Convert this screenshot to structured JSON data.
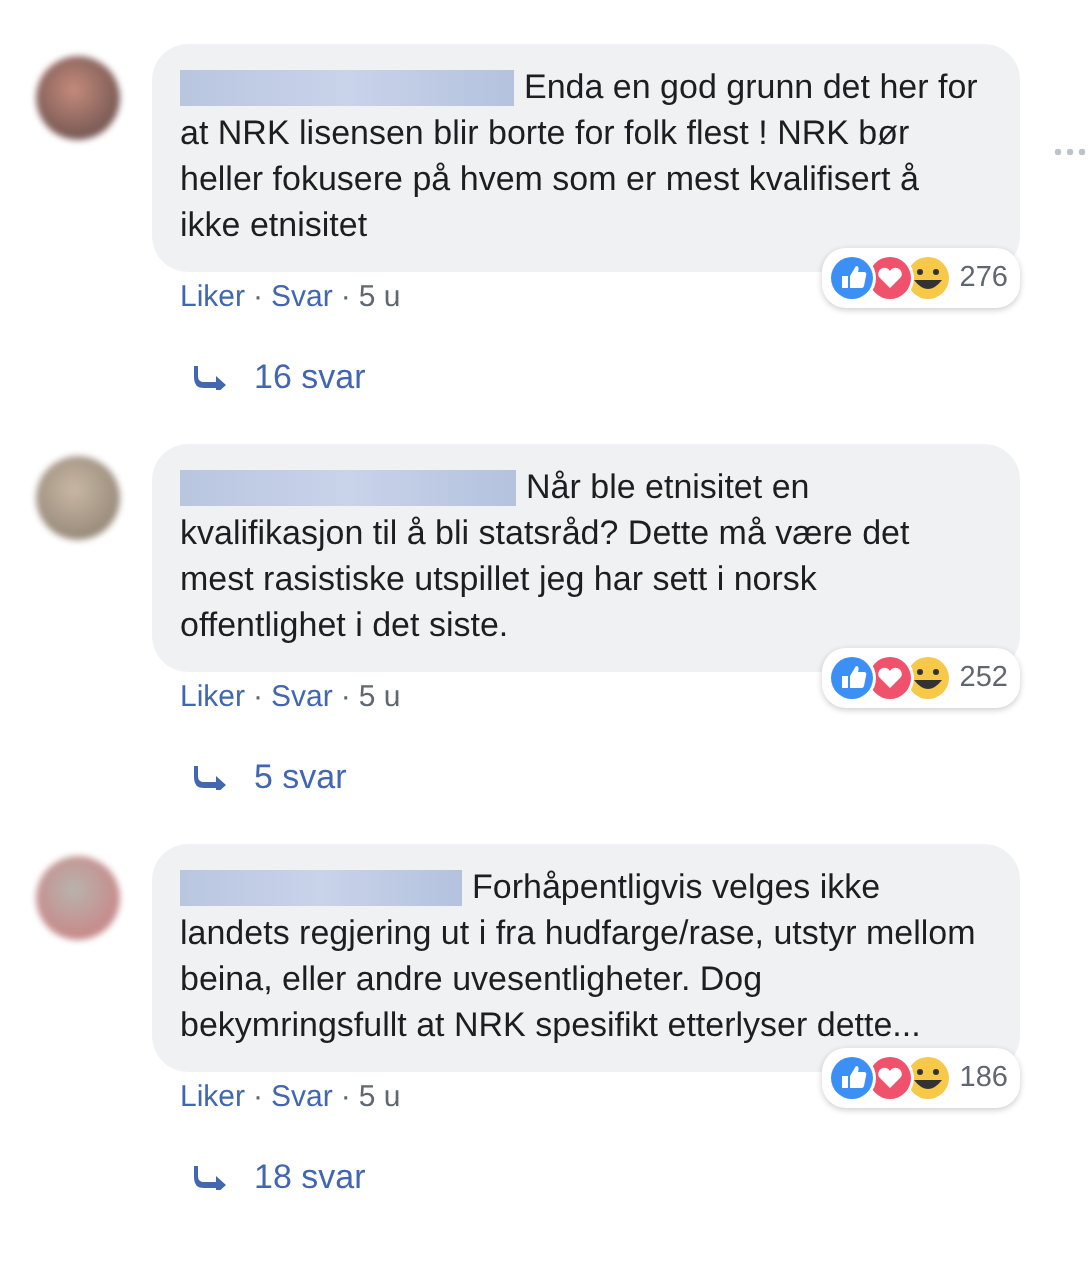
{
  "comments": [
    {
      "text": "Enda en god grunn det her for at NRK lisensen blir borte for folk flest ! NRK bør heller fokusere på hvem som er mest kvalifisert å ikke etnisitet",
      "reaction_count": "276",
      "like": "Liker",
      "separator": "·",
      "reply": "Svar",
      "time": "5 u",
      "replies": "16 svar",
      "menu_visible": true
    },
    {
      "text": "Når ble etnisitet en kvalifikasjon til å bli statsråd? Dette må være det mest rasistiske utspillet jeg har sett i norsk offentlighet i det siste.",
      "reaction_count": "252",
      "like": "Liker",
      "separator": "·",
      "reply": "Svar",
      "time": "5 u",
      "replies": "5 svar",
      "menu_visible": false
    },
    {
      "text": "Forhåpentligvis velges ikke landets regjering ut i fra hudfarge/rase, utstyr mellom beina, eller andre uvesentligheter. Dog bekymringsfullt at NRK spesifikt etterlyser dette...",
      "reaction_count": "186",
      "like": "Liker",
      "separator": "·",
      "reply": "Svar",
      "time": "5 u",
      "replies": "18 svar",
      "menu_visible": false
    }
  ]
}
